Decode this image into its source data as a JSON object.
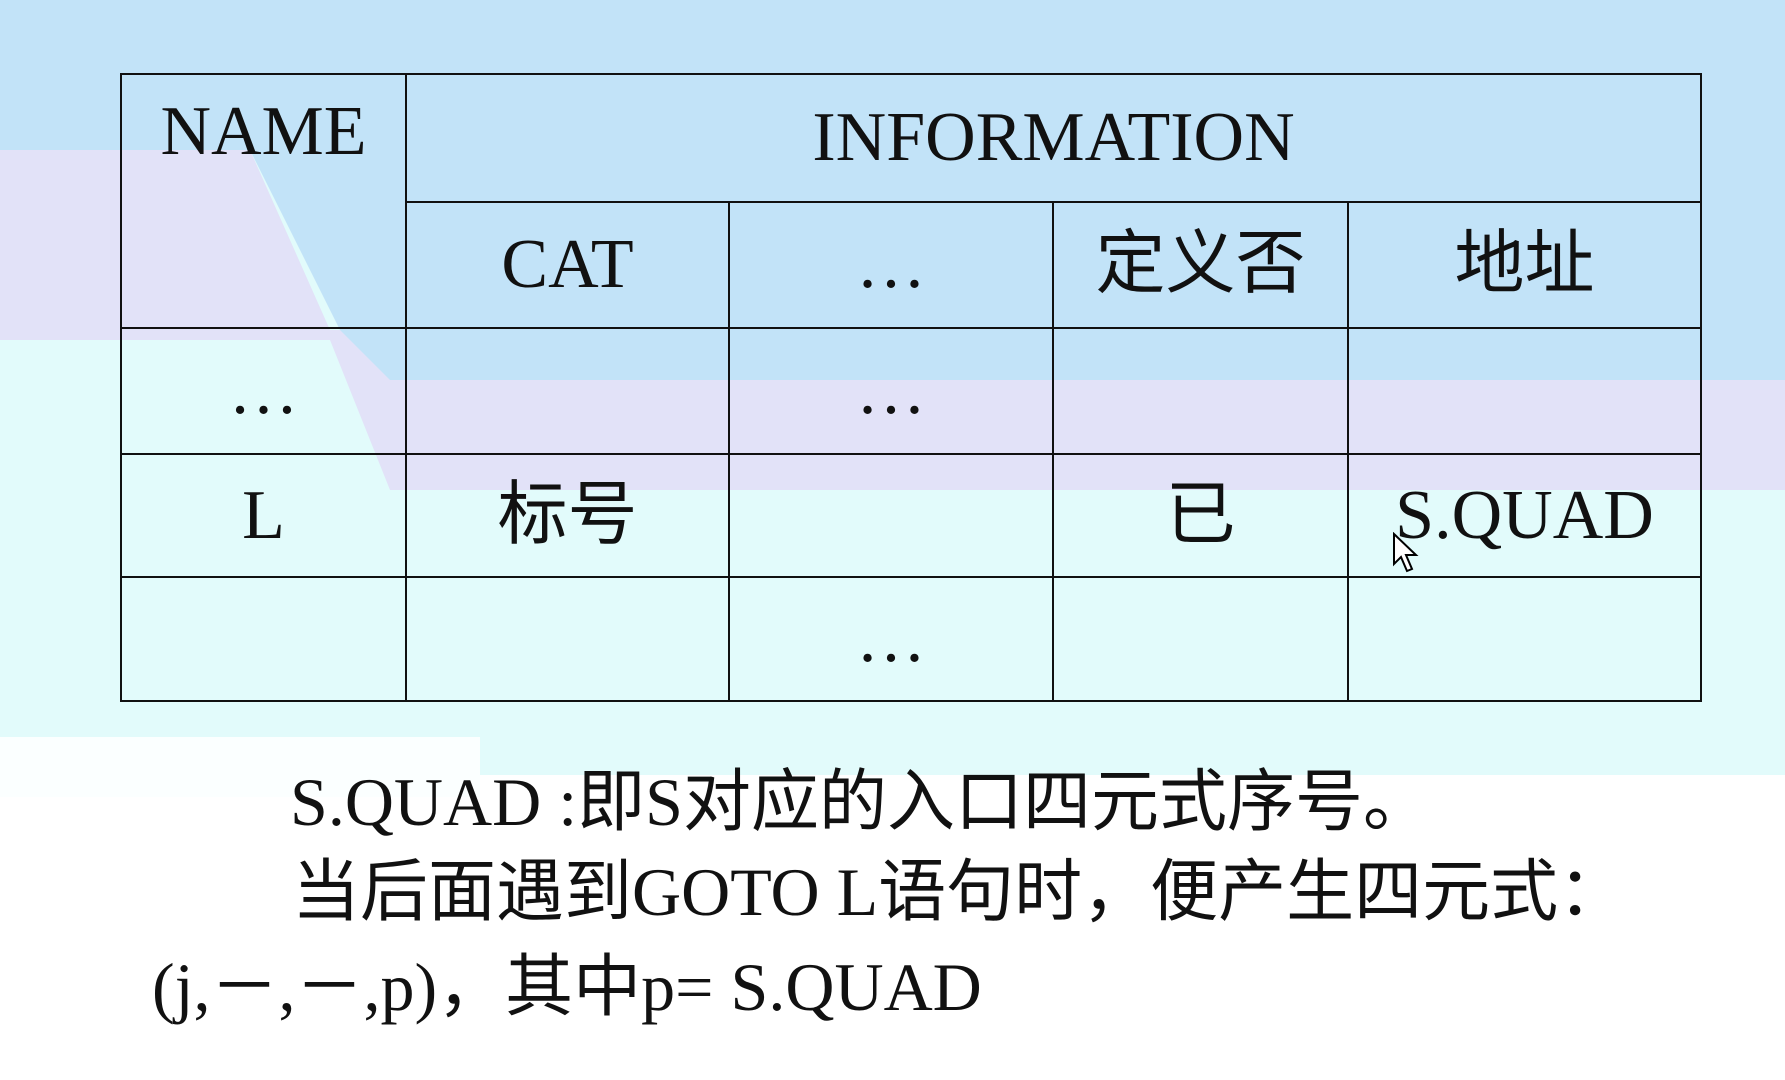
{
  "table": {
    "header": {
      "name": "NAME",
      "information": "INFORMATION"
    },
    "subheaders": [
      "CAT",
      "…",
      "定义否",
      "地址"
    ],
    "rows": [
      [
        "…",
        "",
        "…",
        "",
        ""
      ],
      [
        "L",
        "标号",
        "",
        "已",
        "S.QUAD"
      ],
      [
        "",
        "",
        "…",
        "",
        ""
      ]
    ]
  },
  "notes": {
    "line1": "S.QUAD :即S对应的入口四元式序号。",
    "line2": "当后面遇到GOTO L语句时，便产生四元式：",
    "line3": "(j,－,－,p)，其中p= S.QUAD"
  },
  "colors": {
    "top_band": "#c2e3f8",
    "lavender_band": "#e2e2f8",
    "cyan_band": "#e2fbfb"
  },
  "icons": {
    "cursor": "mouse-pointer-icon"
  }
}
